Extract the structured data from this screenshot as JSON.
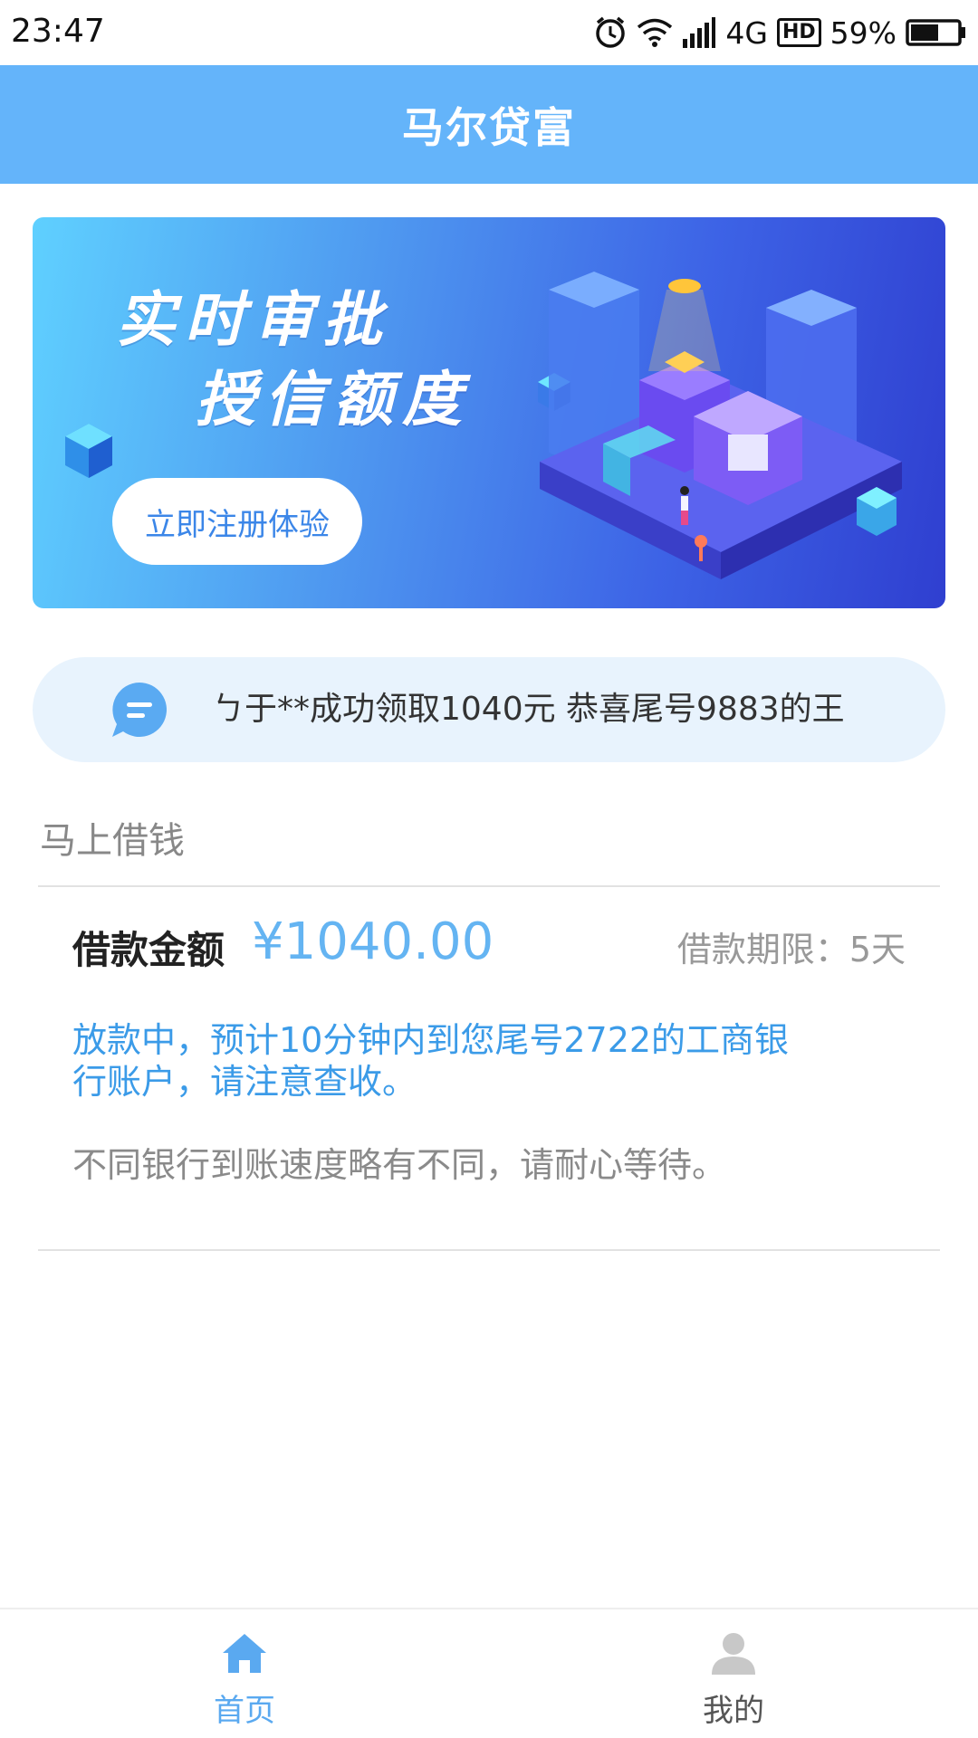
{
  "status_bar": {
    "time": "23:47",
    "network": "4G",
    "hd": "HD",
    "battery": "59%",
    "icons": [
      "alarm-icon",
      "wifi-icon",
      "signal-icon",
      "battery-icon"
    ],
    "battery_level": 0.59
  },
  "header": {
    "title": "马尔贷富"
  },
  "banner": {
    "line1": "实时审批",
    "line2": "授信额度",
    "cta_label": "立即注册体验"
  },
  "notice": {
    "icon": "chat-bubble-icon",
    "text": "ㄅ于**成功领取1040元 恭喜尾号9883的王"
  },
  "section": {
    "title": "马上借钱"
  },
  "loan": {
    "amount_label": "借款金额",
    "amount": "¥1040.00",
    "term": "借款期限：5天",
    "status": "放款中，预计10分钟内到您尾号2722的工商银行账户，请注意查收。",
    "note": "不同银行到账速度略有不同，请耐心等待。"
  },
  "nav": {
    "items": [
      {
        "label": "首页",
        "icon": "home-icon",
        "active": true
      },
      {
        "label": "我的",
        "icon": "user-icon",
        "active": false
      }
    ]
  },
  "colors": {
    "primary": "#64b4fa",
    "accent_text": "#3b9be8",
    "notice_bg": "#e8f3fd"
  }
}
